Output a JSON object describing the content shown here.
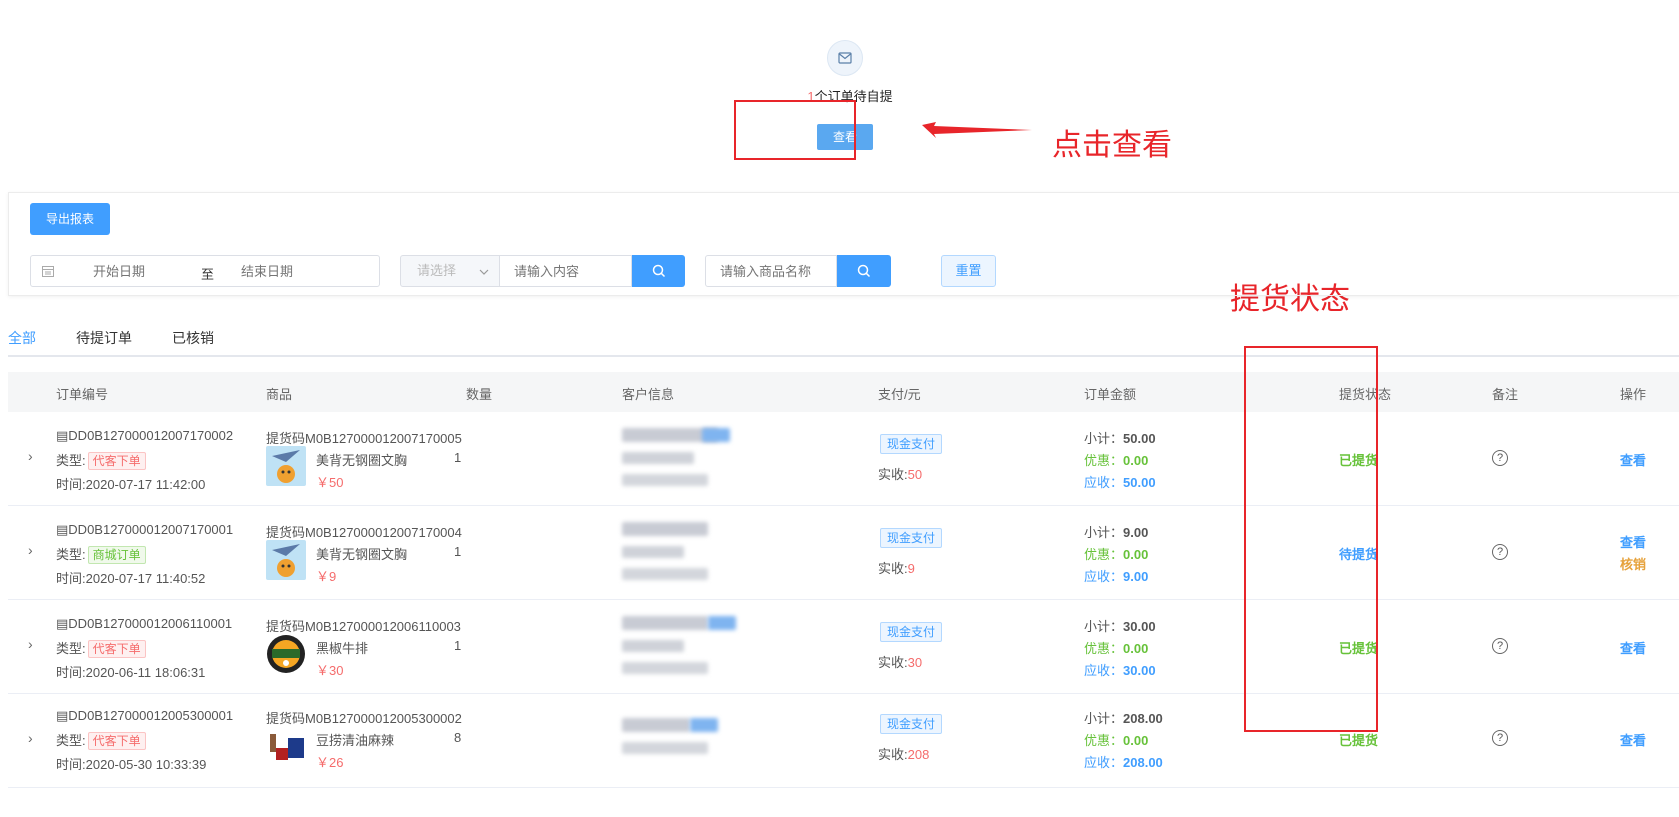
{
  "summary": {
    "count": "1",
    "pending_text": "个订单待自提",
    "view_button": "查看"
  },
  "annotations": {
    "click_view": "点击查看",
    "status_label": "提货状态",
    "color": "#e8252a"
  },
  "filters": {
    "export_button": "导出报表",
    "start_date_placeholder": "开始日期",
    "to_label": "至",
    "end_date_placeholder": "结束日期",
    "select_placeholder": "请选择",
    "content_placeholder": "请输入内容",
    "product_placeholder": "请输入商品名称",
    "reset_button": "重置"
  },
  "tabs": [
    "全部",
    "待提订单",
    "已核销"
  ],
  "columns": {
    "order_no": "订单编号",
    "product": "商品",
    "qty": "数量",
    "customer": "客户信息",
    "payment": "支付/元",
    "amount": "订单金额",
    "pickup_status": "提货状态",
    "remark": "备注",
    "action": "操作"
  },
  "labels": {
    "type": "类型:",
    "time_prefix": "时间:",
    "paid_prefix": "实收:",
    "subtotal": "小计：",
    "discount": "优惠：",
    "receivable": "应收："
  },
  "orders": [
    {
      "order_no": "DD0B127000012007170002",
      "type": "代客下单",
      "time": "2020-07-17 11:42:00",
      "pickup_code": "提货码M0B127000012007170005",
      "product_name": "美背无钢圈文胸",
      "price": "￥50",
      "qty": "1",
      "pay_method": "现金支付",
      "paid": "50",
      "subtotal": "50.00",
      "discount": "0.00",
      "receivable": "50.00",
      "status": "已提货",
      "actions": [
        "查看"
      ]
    },
    {
      "order_no": "DD0B127000012007170001",
      "type": "商城订单",
      "time": "2020-07-17 11:40:52",
      "pickup_code": "提货码M0B127000012007170004",
      "product_name": "美背无钢圈文胸",
      "price": "￥9",
      "qty": "1",
      "pay_method": "现金支付",
      "paid": "9",
      "subtotal": "9.00",
      "discount": "0.00",
      "receivable": "9.00",
      "status": "待提货",
      "actions": [
        "查看",
        "核销"
      ]
    },
    {
      "order_no": "DD0B127000012006110001",
      "type": "代客下单",
      "time": "2020-06-11 18:06:31",
      "pickup_code": "提货码M0B127000012006110003",
      "product_name": "黑椒牛排",
      "price": "￥30",
      "qty": "1",
      "pay_method": "现金支付",
      "paid": "30",
      "subtotal": "30.00",
      "discount": "0.00",
      "receivable": "30.00",
      "status": "已提货",
      "actions": [
        "查看"
      ]
    },
    {
      "order_no": "DD0B127000012005300001",
      "type": "代客下单",
      "time": "2020-05-30 10:33:39",
      "pickup_code": "提货码M0B127000012005300002",
      "product_name": "豆捞清油麻辣",
      "price": "￥26",
      "qty": "8",
      "pay_method": "现金支付",
      "paid": "208",
      "subtotal": "208.00",
      "discount": "0.00",
      "receivable": "208.00",
      "status": "已提货",
      "actions": [
        "查看"
      ]
    }
  ],
  "colors": {
    "primary": "#409eff",
    "success": "#67c23a",
    "danger": "#f56c6c",
    "warning": "#e6a23c"
  }
}
